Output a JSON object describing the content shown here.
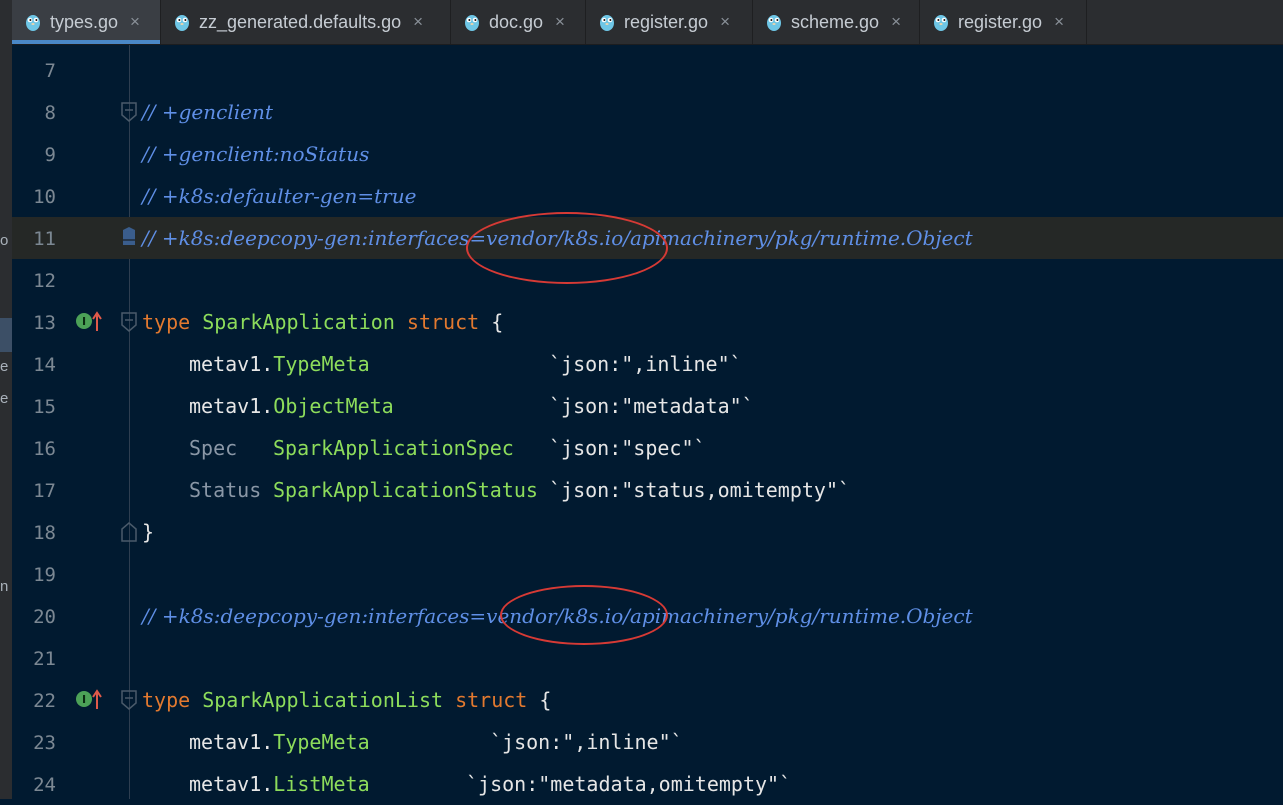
{
  "left_panel": {
    "fragments": [
      "o",
      "e",
      "e",
      "n"
    ]
  },
  "tabs": [
    {
      "label": "types.go",
      "active": true
    },
    {
      "label": "zz_generated.defaults.go",
      "active": false
    },
    {
      "label": "doc.go",
      "active": false
    },
    {
      "label": "register.go",
      "active": false
    },
    {
      "label": "scheme.go",
      "active": false
    },
    {
      "label": "register.go",
      "active": false
    }
  ],
  "tab_close_glyph": "×",
  "code": {
    "l7": "7",
    "l8": "8",
    "l8_text": "// +genclient",
    "l9": "9",
    "l9_text": "// +genclient:noStatus",
    "l10": "10",
    "l10_text": "// +k8s:defaulter-gen=true",
    "l11": "11",
    "l11_text": "// +k8s:deepcopy-gen:interfaces=vendor/k8s.io/apimachinery/pkg/runtime.Object",
    "l12": "12",
    "l13": "13",
    "l13_kw": "type",
    "l13_name": "SparkApplication",
    "l13_kw2": "struct",
    "l13_brace": " {",
    "l14": "14",
    "l14_pkg": "metav1.",
    "l14_type": "TypeMeta",
    "l14_tag": "`json:\",inline\"`",
    "l15": "15",
    "l15_pkg": "metav1.",
    "l15_type": "ObjectMeta",
    "l15_tag": "`json:\"metadata\"`",
    "l16": "16",
    "l16_field": "Spec",
    "l16_type": "SparkApplicationSpec",
    "l16_tag": "`json:\"spec\"`",
    "l17": "17",
    "l17_field": "Status",
    "l17_type": "SparkApplicationStatus",
    "l17_tag": "`json:\"status,omitempty\"`",
    "l18": "18",
    "l18_text": "}",
    "l19": "19",
    "l20": "20",
    "l20_text": "// +k8s:deepcopy-gen:interfaces=vendor/k8s.io/apimachinery/pkg/runtime.Object",
    "l21": "21",
    "l22": "22",
    "l22_kw": "type",
    "l22_name": "SparkApplicationList",
    "l22_kw2": "struct",
    "l22_brace": " {",
    "l23": "23",
    "l23_pkg": "metav1.",
    "l23_type": "TypeMeta",
    "l23_tag": "`json:\",inline\"`",
    "l24": "24",
    "l24_pkg": "metav1.",
    "l24_type": "ListMeta",
    "l24_tag": "`json:\"metadata,omitempty\"`"
  },
  "colors": {
    "background": "#011a30",
    "comment": "#5f8fe6",
    "keyword": "#e2792f",
    "type": "#8ddc5b",
    "annotation": "#d63a35"
  },
  "icons": [
    "gopher-icon",
    "close-icon",
    "implemented-icon",
    "fold-icon",
    "bookmark-icon"
  ]
}
